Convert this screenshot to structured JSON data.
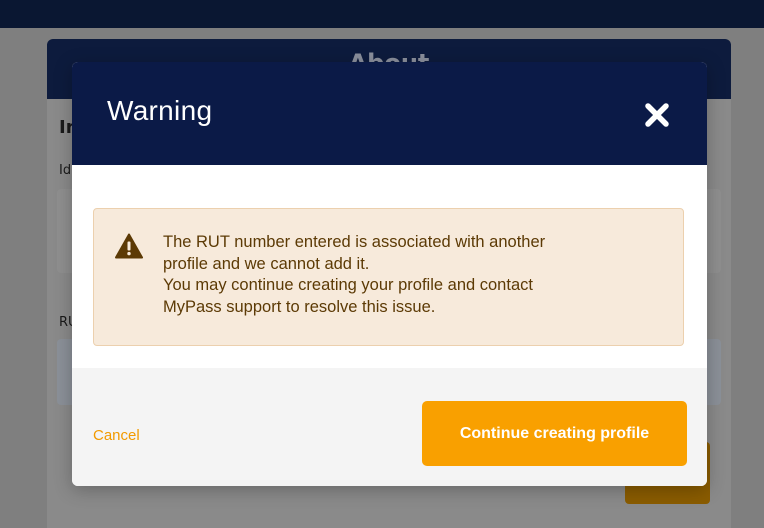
{
  "background": {
    "card_title": "About",
    "section_title": "In",
    "label_1": "Id",
    "label_2": "RU"
  },
  "modal": {
    "title": "Warning",
    "close_icon": "close-icon",
    "alert": {
      "icon": "warning-triangle-icon",
      "lines": [
        "The RUT number entered is associated with another",
        "profile and we cannot add it.",
        "You may continue creating your profile and contact",
        "MyPass support to resolve this issue."
      ]
    },
    "cancel_label": "Cancel",
    "continue_label": "Continue creating profile"
  },
  "colors": {
    "header_bg": "#0b1a47",
    "alert_bg": "#f7eadb",
    "alert_text": "#5c3a05",
    "accent": "#f9a000"
  }
}
